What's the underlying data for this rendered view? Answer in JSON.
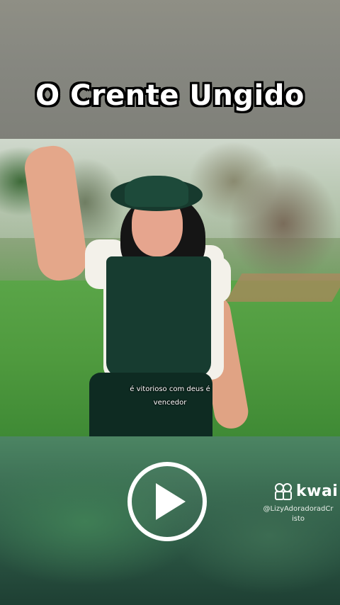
{
  "title": "O Crente Ungido",
  "caption": {
    "line1": "é vitorioso com deus é",
    "line2": "vencedor"
  },
  "player": {
    "play_icon": "play-icon"
  },
  "watermark": {
    "brand": "kwai",
    "brand_icon": "kwai-icon",
    "handle_line1": "@LizyAdoradoradCr",
    "handle_line2": "isto"
  },
  "colors": {
    "title_text": "#ffffff",
    "title_outline": "#000000",
    "play_button": "#ffffff"
  }
}
